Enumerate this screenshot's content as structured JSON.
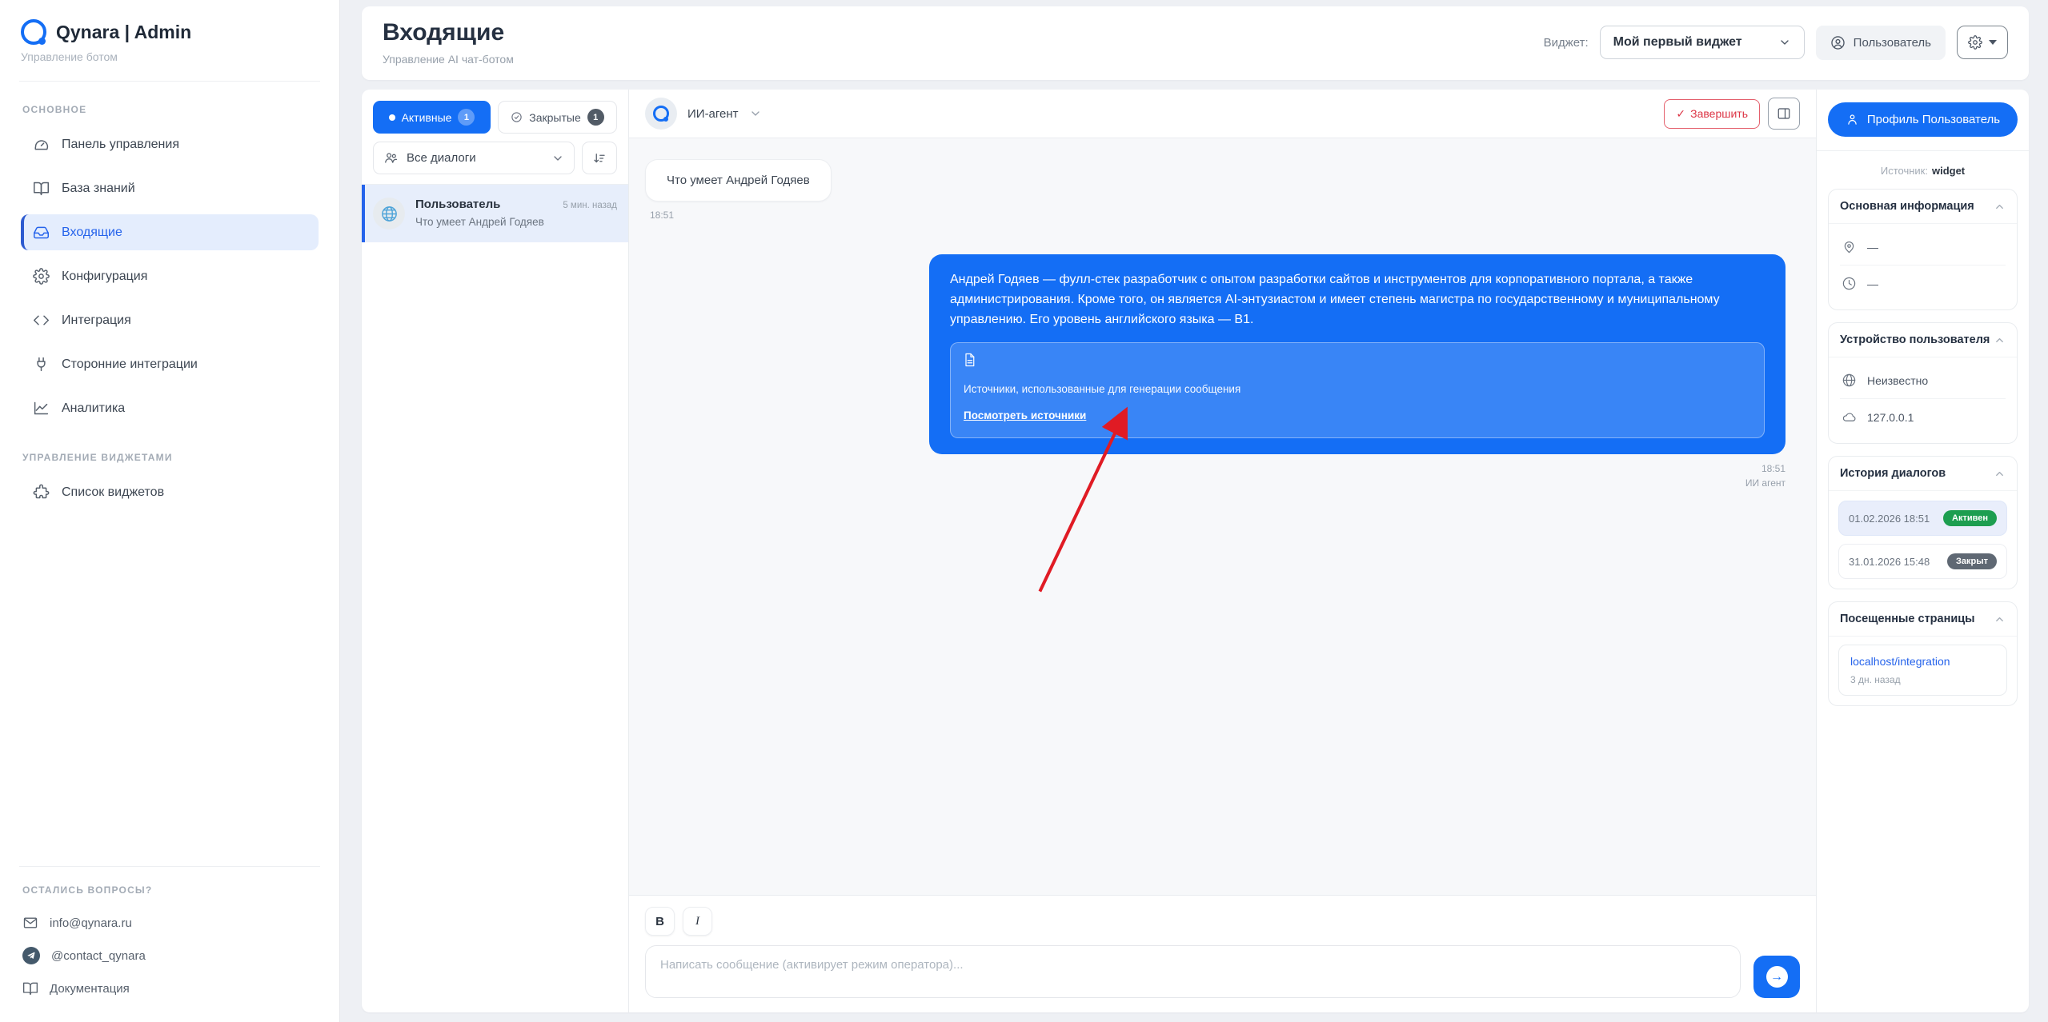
{
  "colors": {
    "accent": "#146ef5",
    "red": "#dc3545",
    "green": "#1d9e50"
  },
  "sidebar": {
    "brand": {
      "title": "Qynara | Admin",
      "subtitle": "Управление ботом"
    },
    "sections": [
      {
        "label": "ОСНОВНОЕ",
        "items": [
          {
            "label": "Панель управления"
          },
          {
            "label": "База знаний"
          },
          {
            "label": "Входящие"
          },
          {
            "label": "Конфигурация"
          },
          {
            "label": "Интеграция"
          },
          {
            "label": "Сторонние интеграции"
          },
          {
            "label": "Аналитика"
          }
        ]
      },
      {
        "label": "УПРАВЛЕНИЕ ВИДЖЕТАМИ",
        "items": [
          {
            "label": "Список виджетов"
          }
        ]
      }
    ],
    "footer": {
      "label": "ОСТАЛИСЬ ВОПРОСЫ?",
      "items": [
        {
          "label": "info@qynara.ru"
        },
        {
          "label": "@contact_qynara"
        },
        {
          "label": "Документация"
        }
      ]
    }
  },
  "header": {
    "title": "Входящие",
    "subtitle": "Управление AI чат-ботом",
    "widget_label": "Виджет:",
    "widget_value": "Мой первый виджет",
    "user_button": "Пользователь"
  },
  "chat_list": {
    "tabs": [
      {
        "label": "Активные",
        "count": "1"
      },
      {
        "label": "Закрытые",
        "count": "1"
      }
    ],
    "filter": "Все диалоги",
    "items": [
      {
        "name": "Пользователь",
        "time": "5 мин. назад",
        "preview": "Что умеет Андрей Годяев"
      }
    ]
  },
  "chat": {
    "agent_name": "ИИ-агент",
    "finish_button": "Завершить",
    "finish_check": "✓",
    "user_message": {
      "text": "Что умеет Андрей Годяев",
      "time": "18:51"
    },
    "ai_message": {
      "text": "Андрей Годяев — фулл-стек разработчик с опытом разработки сайтов и инструментов для корпоративного портала, а также администрирования. Кроме того, он является AI-энтузиастом и имеет степень магистра по государственному и муниципальному управлению. Его уровень английского языка — B1.",
      "sources_label": "Источники, использованные для генерации сообщения",
      "sources_link": "Посмотреть источники",
      "time": "18:51",
      "sender": "ИИ агент"
    },
    "composer": {
      "bold": "B",
      "italic": "I",
      "placeholder": "Написать сообщение (активирует режим оператора)...",
      "send_arrow": "→"
    }
  },
  "profile": {
    "button": "Профиль Пользователь",
    "source_label": "Источник:",
    "source_value": "widget",
    "info_card": {
      "title": "Основная информация",
      "location": "—",
      "time": "—"
    },
    "device_card": {
      "title": "Устройство пользователя",
      "browser": "Неизвестно",
      "ip": "127.0.0.1"
    },
    "history_card": {
      "title": "История диалогов",
      "entries": [
        {
          "date": "01.02.2026 18:51",
          "status": "Активен"
        },
        {
          "date": "31.01.2026 15:48",
          "status": "Закрыт"
        }
      ]
    },
    "pages_card": {
      "title": "Посещенные страницы",
      "url": "localhost/integration",
      "time": "3 дн. назад"
    }
  }
}
